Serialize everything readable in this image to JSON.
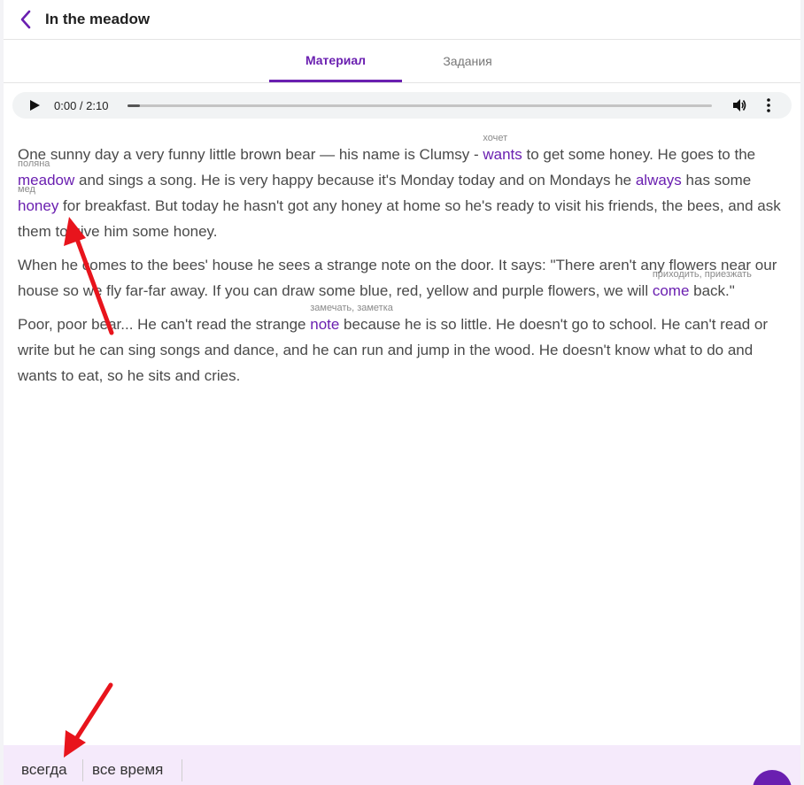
{
  "header": {
    "title": "In the meadow",
    "back_icon": "chevron-left-icon"
  },
  "tabs": [
    {
      "label": "Материал",
      "active": true
    },
    {
      "label": "Задания",
      "active": false
    }
  ],
  "player": {
    "time": "0:00 / 2:10",
    "progress": 0.0
  },
  "text": {
    "p1": {
      "s1": "One sunny day a very funny little brown bear — his name is Clumsy - ",
      "w1": "wants",
      "g1": "хочет",
      "s2": " to get some honey. He goes to the ",
      "w2": "meadow",
      "g2": "поляна",
      "s3": " and sings a song. He is very happy because it's Monday today and on Mondays he ",
      "w3": "always",
      "s4": " has some ",
      "w4": "honey",
      "g4": "мед",
      "s5": " for breakfast. But today he hasn't got any honey at home so he's ready to visit his friends, the bees, and ask them to give him some honey."
    },
    "p2": {
      "s1": "When he comes to the bees' house he sees a strange note on the door. It says: \"There aren't any flowers near our house so we fly far-far away. If you can draw some blue, red, yellow and purple flowers, we will ",
      "w1": "come",
      "g1": "приходить, приезжать",
      "s2": " back.\""
    },
    "p3": {
      "s1": "Poor, poor bear... He can't read the strange ",
      "w1": "note",
      "g1": "замечать, заметка",
      "s2": " because he is so little. He doesn't go to school. He can't read or write but he can sing songs and dance, and he can run and jump in the wood. He doesn't know what to do and wants to eat, so he sits and cries."
    }
  },
  "translations": [
    "всегда",
    "все время"
  ],
  "colors": {
    "accent": "#6a1fb0",
    "annotation_arrow": "#e8141c",
    "bottom_bar": "#f5eafb"
  }
}
